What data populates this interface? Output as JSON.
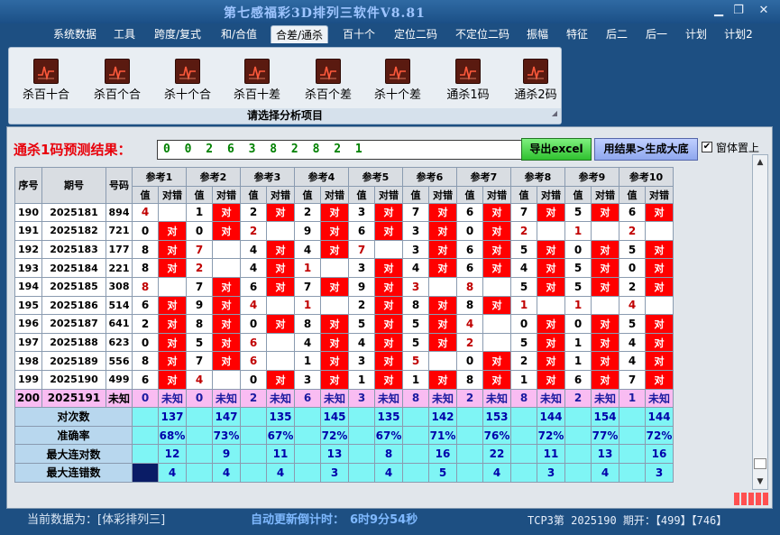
{
  "window": {
    "title": "第七感福彩3D排列三软件V8.81",
    "minimize_glyph": "▁",
    "restore_glyph": "❐",
    "close_glyph": "✕"
  },
  "menu": [
    "系统数据",
    "工具",
    "跨度/复式",
    "和/合值",
    "合差/通杀",
    "百十个",
    "定位二码",
    "不定位二码",
    "振幅",
    "特征",
    "后二",
    "后一",
    "计划",
    "计划2"
  ],
  "menu_active_index": 4,
  "ribbon": {
    "buttons": [
      "杀百十合",
      "杀百个合",
      "杀十个合",
      "杀百十差",
      "杀百个差",
      "杀十个差",
      "通杀1码",
      "通杀2码"
    ],
    "icon": "chart-icon",
    "caption": "请选择分析项目"
  },
  "prediction": {
    "label": "通杀1码预测结果：",
    "value": "0 0 2 6 3 8 2 8 2 1",
    "excel_button": "导出excel",
    "generate_button": "用结果>生成大底",
    "ontop_checked": true,
    "ontop_label": "窗体置上"
  },
  "table": {
    "headers": {
      "idx": "序号",
      "period": "期号",
      "number": "号码",
      "value": "值",
      "check": "对错"
    },
    "refs": [
      "参考1",
      "参考2",
      "参考3",
      "参考4",
      "参考5",
      "参考6",
      "参考7",
      "参考8",
      "参考9",
      "参考10"
    ],
    "hit_text": "对",
    "unknown_text": "未知",
    "rows": [
      {
        "idx": "190",
        "period": "2025181",
        "number": "894",
        "vals": [
          "4",
          "1",
          "2",
          "2",
          "3",
          "7",
          "6",
          "7",
          "5",
          "6"
        ],
        "red": [
          0
        ],
        "hits": [
          0,
          1,
          1,
          1,
          1,
          1,
          1,
          1,
          1,
          1
        ]
      },
      {
        "idx": "191",
        "period": "2025182",
        "number": "721",
        "vals": [
          "0",
          "0",
          "2",
          "9",
          "6",
          "3",
          "0",
          "2",
          "1",
          "2"
        ],
        "red": [
          2,
          7,
          8,
          9
        ],
        "hits": [
          1,
          1,
          0,
          1,
          1,
          1,
          1,
          0,
          0,
          0
        ]
      },
      {
        "idx": "192",
        "period": "2025183",
        "number": "177",
        "vals": [
          "8",
          "7",
          "4",
          "4",
          "7",
          "3",
          "6",
          "5",
          "0",
          "5"
        ],
        "red": [
          1,
          4
        ],
        "hits": [
          1,
          0,
          1,
          1,
          0,
          1,
          1,
          1,
          1,
          1
        ]
      },
      {
        "idx": "193",
        "period": "2025184",
        "number": "221",
        "vals": [
          "8",
          "2",
          "4",
          "1",
          "3",
          "4",
          "6",
          "4",
          "5",
          "0"
        ],
        "red": [
          1,
          3
        ],
        "hits": [
          1,
          0,
          1,
          0,
          1,
          1,
          1,
          1,
          1,
          1
        ]
      },
      {
        "idx": "194",
        "period": "2025185",
        "number": "308",
        "vals": [
          "8",
          "7",
          "6",
          "7",
          "9",
          "3",
          "8",
          "5",
          "5",
          "2"
        ],
        "red": [
          0,
          5,
          6
        ],
        "hits": [
          0,
          1,
          1,
          1,
          1,
          0,
          0,
          1,
          1,
          1
        ]
      },
      {
        "idx": "195",
        "period": "2025186",
        "number": "514",
        "vals": [
          "6",
          "9",
          "4",
          "1",
          "2",
          "8",
          "8",
          "1",
          "1",
          "4"
        ],
        "red": [
          2,
          3,
          7,
          8,
          9
        ],
        "hits": [
          1,
          1,
          0,
          0,
          1,
          1,
          1,
          0,
          0,
          0
        ]
      },
      {
        "idx": "196",
        "period": "2025187",
        "number": "641",
        "vals": [
          "2",
          "8",
          "0",
          "8",
          "5",
          "5",
          "4",
          "0",
          "0",
          "5"
        ],
        "red": [
          6
        ],
        "hits": [
          1,
          1,
          1,
          1,
          1,
          1,
          0,
          1,
          1,
          1
        ]
      },
      {
        "idx": "197",
        "period": "2025188",
        "number": "623",
        "vals": [
          "0",
          "5",
          "6",
          "4",
          "4",
          "5",
          "2",
          "5",
          "1",
          "4"
        ],
        "red": [
          2,
          6
        ],
        "hits": [
          1,
          1,
          0,
          1,
          1,
          1,
          0,
          1,
          1,
          1
        ]
      },
      {
        "idx": "198",
        "period": "2025189",
        "number": "556",
        "vals": [
          "8",
          "7",
          "6",
          "1",
          "3",
          "5",
          "0",
          "2",
          "1",
          "4"
        ],
        "red": [
          2,
          5
        ],
        "hits": [
          1,
          1,
          0,
          1,
          1,
          0,
          1,
          1,
          1,
          1
        ]
      },
      {
        "idx": "199",
        "period": "2025190",
        "number": "499",
        "vals": [
          "6",
          "4",
          "0",
          "3",
          "1",
          "1",
          "8",
          "1",
          "6",
          "7"
        ],
        "red": [
          1
        ],
        "hits": [
          1,
          0,
          1,
          1,
          1,
          1,
          1,
          1,
          1,
          1
        ]
      },
      {
        "idx": "200",
        "period": "2025191",
        "number": "未知",
        "vals": [
          "0",
          "0",
          "2",
          "6",
          "3",
          "8",
          "2",
          "8",
          "2",
          "1"
        ],
        "unknown": true
      }
    ],
    "stats": [
      {
        "label": "对次数",
        "values": [
          "137",
          "147",
          "135",
          "145",
          "135",
          "142",
          "153",
          "144",
          "154",
          "144"
        ]
      },
      {
        "label": "准确率",
        "values": [
          "68%",
          "73%",
          "67%",
          "72%",
          "67%",
          "71%",
          "76%",
          "72%",
          "77%",
          "72%"
        ]
      },
      {
        "label": "最大连对数",
        "values": [
          "12",
          "9",
          "11",
          "13",
          "8",
          "16",
          "22",
          "11",
          "13",
          "16"
        ]
      },
      {
        "label": "最大连错数",
        "values": [
          "4",
          "4",
          "4",
          "3",
          "4",
          "5",
          "4",
          "3",
          "4",
          "3"
        ]
      }
    ]
  },
  "status": {
    "current_data": "当前数据为：[体彩排列三]",
    "countdown_label": "自动更新倒计时：",
    "countdown_value": "6时9分54秒",
    "latest": "TCP3第 2025190 期开：【499】【746】"
  },
  "colors": {
    "hit": "#ff0000",
    "unknown_row": "#f9bcf2",
    "stats": "#7ff5f5",
    "prediction_text": "#008000",
    "label_red": "#e8000a"
  }
}
